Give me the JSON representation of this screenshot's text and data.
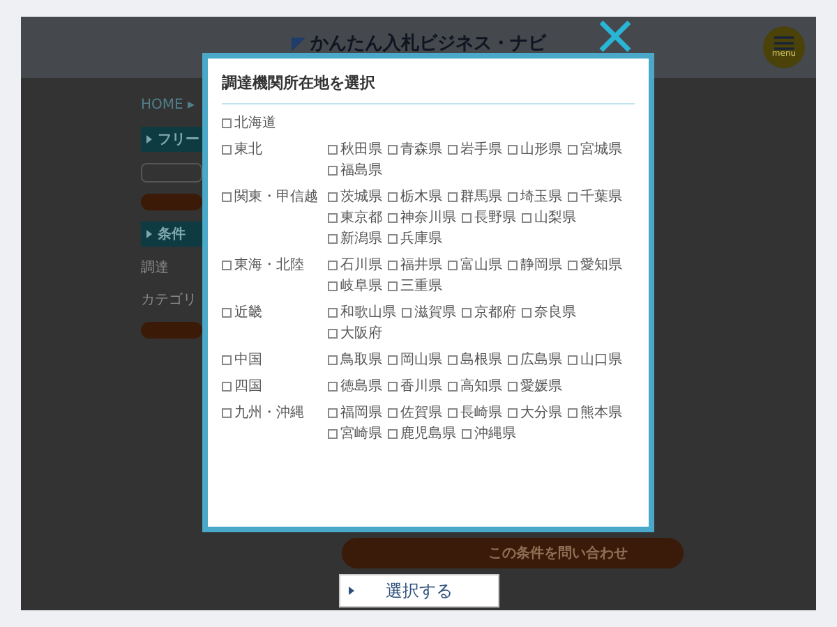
{
  "page": {
    "logo": "かんたん入札ビジネス・ナビ",
    "menu_label": "menu",
    "breadcrumb": "HOME ▸",
    "freeword_heading": "フリー",
    "conditions_heading": "条件",
    "location_label": "調達",
    "category_label": "カテゴリ",
    "inquiry_button": "この条件を問い合わせ"
  },
  "modal": {
    "title": "調達機関所在地を選択",
    "regions": [
      {
        "name": "北海道",
        "checked": false
      },
      {
        "name": "東北",
        "checked": false,
        "prefectures": [
          {
            "name": "秋田県",
            "checked": false
          },
          {
            "name": "青森県",
            "checked": false
          },
          {
            "name": "岩手県",
            "checked": false
          },
          {
            "name": "山形県",
            "checked": false
          },
          {
            "name": "宮城県",
            "checked": false
          },
          {
            "name": "福島県",
            "checked": false
          }
        ]
      },
      {
        "name": "関東・甲信越",
        "checked": false,
        "prefectures": [
          {
            "name": "茨城県",
            "checked": false
          },
          {
            "name": "栃木県",
            "checked": false
          },
          {
            "name": "群馬県",
            "checked": false
          },
          {
            "name": "埼玉県",
            "checked": false
          },
          {
            "name": "千葉県",
            "checked": false
          },
          {
            "name": "東京都",
            "checked": false
          },
          {
            "name": "神奈川県",
            "checked": false
          },
          {
            "name": "長野県",
            "checked": false
          },
          {
            "name": "山梨県",
            "checked": false
          },
          {
            "name": "新潟県",
            "checked": false
          },
          {
            "name": "兵庫県",
            "checked": false
          }
        ]
      },
      {
        "name": "東海・北陸",
        "checked": false,
        "prefectures": [
          {
            "name": "石川県",
            "checked": false
          },
          {
            "name": "福井県",
            "checked": false
          },
          {
            "name": "富山県",
            "checked": false
          },
          {
            "name": "静岡県",
            "checked": false
          },
          {
            "name": "愛知県",
            "checked": false
          },
          {
            "name": "岐阜県",
            "checked": false
          },
          {
            "name": "三重県",
            "checked": false
          }
        ]
      },
      {
        "name": "近畿",
        "checked": false,
        "prefectures": [
          {
            "name": "和歌山県",
            "checked": false
          },
          {
            "name": "滋賀県",
            "checked": false
          },
          {
            "name": "京都府",
            "checked": false
          },
          {
            "name": "奈良県",
            "checked": false
          },
          {
            "name": "大阪府",
            "checked": false
          }
        ]
      },
      {
        "name": "中国",
        "checked": false,
        "prefectures": [
          {
            "name": "鳥取県",
            "checked": false
          },
          {
            "name": "岡山県",
            "checked": false
          },
          {
            "name": "島根県",
            "checked": false
          },
          {
            "name": "広島県",
            "checked": false
          },
          {
            "name": "山口県",
            "checked": false
          }
        ]
      },
      {
        "name": "四国",
        "checked": false,
        "prefectures": [
          {
            "name": "徳島県",
            "checked": false
          },
          {
            "name": "香川県",
            "checked": false
          },
          {
            "name": "高知県",
            "checked": false
          },
          {
            "name": "愛媛県",
            "checked": false
          }
        ]
      },
      {
        "name": "九州・沖縄",
        "checked": false,
        "prefectures": [
          {
            "name": "福岡県",
            "checked": false
          },
          {
            "name": "佐賀県",
            "checked": false
          },
          {
            "name": "長崎県",
            "checked": false
          },
          {
            "name": "大分県",
            "checked": false
          },
          {
            "name": "熊本県",
            "checked": false
          },
          {
            "name": "宮崎県",
            "checked": false
          },
          {
            "name": "鹿児島県",
            "checked": false
          },
          {
            "name": "沖縄県",
            "checked": false
          }
        ]
      }
    ],
    "select_button": "選択する"
  }
}
